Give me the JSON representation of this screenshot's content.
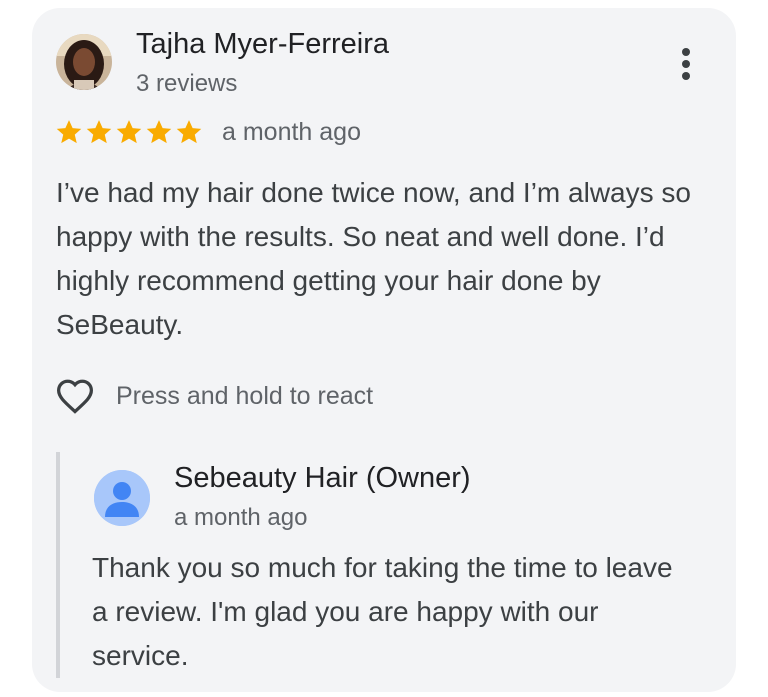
{
  "review": {
    "author": "Tajha Myer-Ferreira",
    "author_meta": "3 reviews",
    "rating": 5,
    "rating_max": 5,
    "date": "a month ago",
    "text": "I’ve had my hair done twice now, and I’m always so happy with the results. So neat and well done. I’d highly recommend getting your hair done by SeBeauty.",
    "react_label": "Press and hold to react",
    "star_color": "#f9ab00",
    "icons": {
      "more": "more-vert-icon",
      "react": "heart-outline-icon",
      "star": "star-icon"
    }
  },
  "reply": {
    "author": "Sebeauty Hair (Owner)",
    "date": "a month ago",
    "text": "Thank you so much for taking the time to leave a review. I'm glad you are happy with our service.",
    "avatar_color": "#a8c7fa",
    "avatar_icon": "person-icon"
  }
}
